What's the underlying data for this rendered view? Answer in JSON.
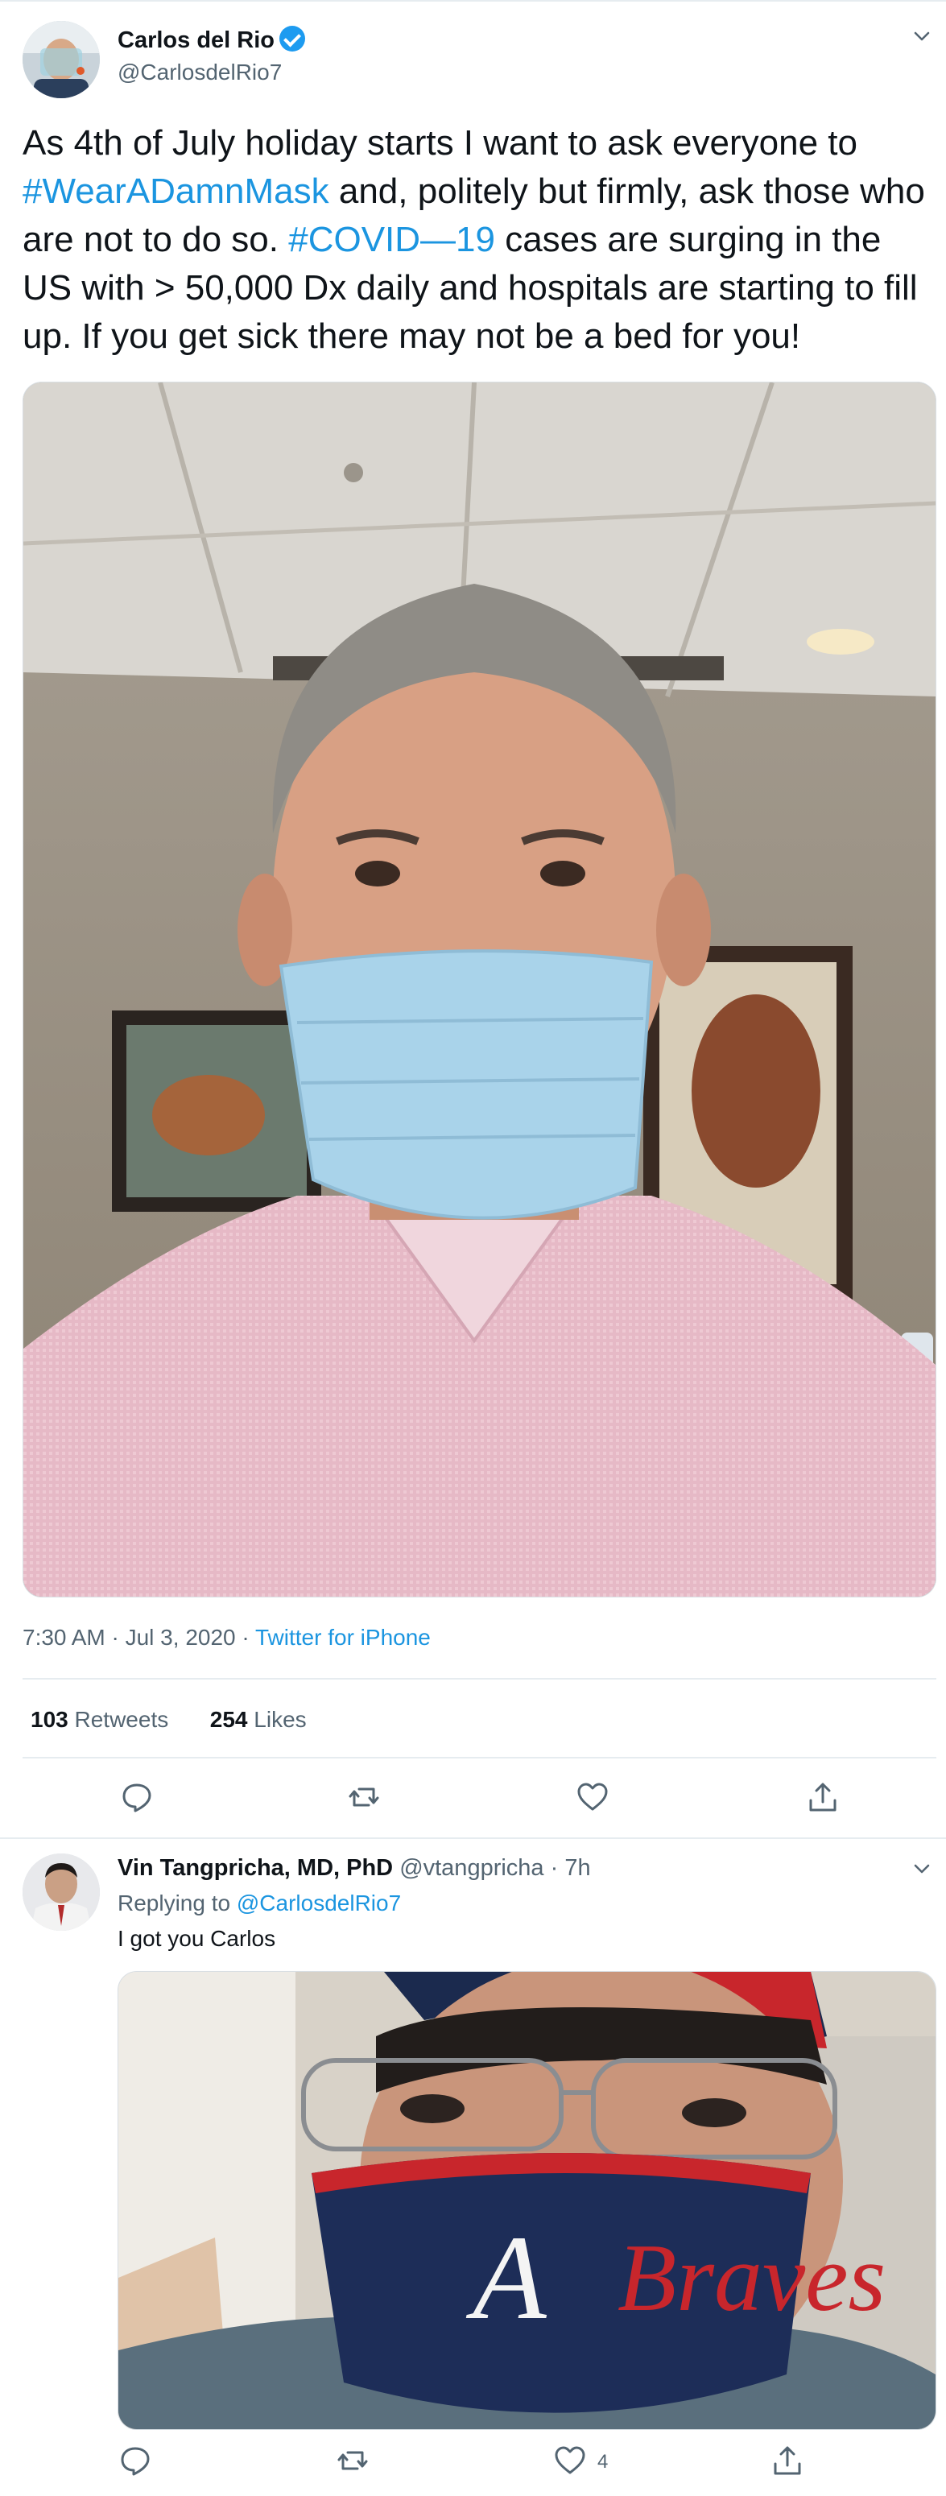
{
  "tweet": {
    "author_name": "Carlos del Rio",
    "author_handle": "@CarlosdelRio7",
    "text_parts": [
      "As 4th of July holiday starts I want to ask everyone to ",
      "#WearADamnMask",
      " and, politely but firmly, ask those who are not to do so. ",
      "#COVID—19",
      " cases are surging in the US with > 50,000 Dx daily and hospitals are starting to fill up. If you get sick there may not be a bed for you!"
    ],
    "timestamp": "7:30 AM · Jul 3, 2020 · ",
    "source": "Twitter for iPhone",
    "retweets_count": "103",
    "retweets_label": "Retweets",
    "likes_count": "254",
    "likes_label": "Likes"
  },
  "reply": {
    "author_name": "Vin Tangpricha, MD, PhD",
    "author_handle": "@vtangpricha · 7h",
    "replying_label": "Replying to ",
    "replying_to": "@CarlosdelRio7",
    "text": "I got you Carlos",
    "like_count": "4"
  },
  "icons": [
    "verified-badge-icon",
    "chevron-down-icon",
    "reply-icon",
    "retweet-icon",
    "like-icon",
    "share-icon"
  ],
  "colors": {
    "link": "#1b95e0",
    "muted": "#536471",
    "text": "#0f1419",
    "divider": "#e6ecf0"
  }
}
